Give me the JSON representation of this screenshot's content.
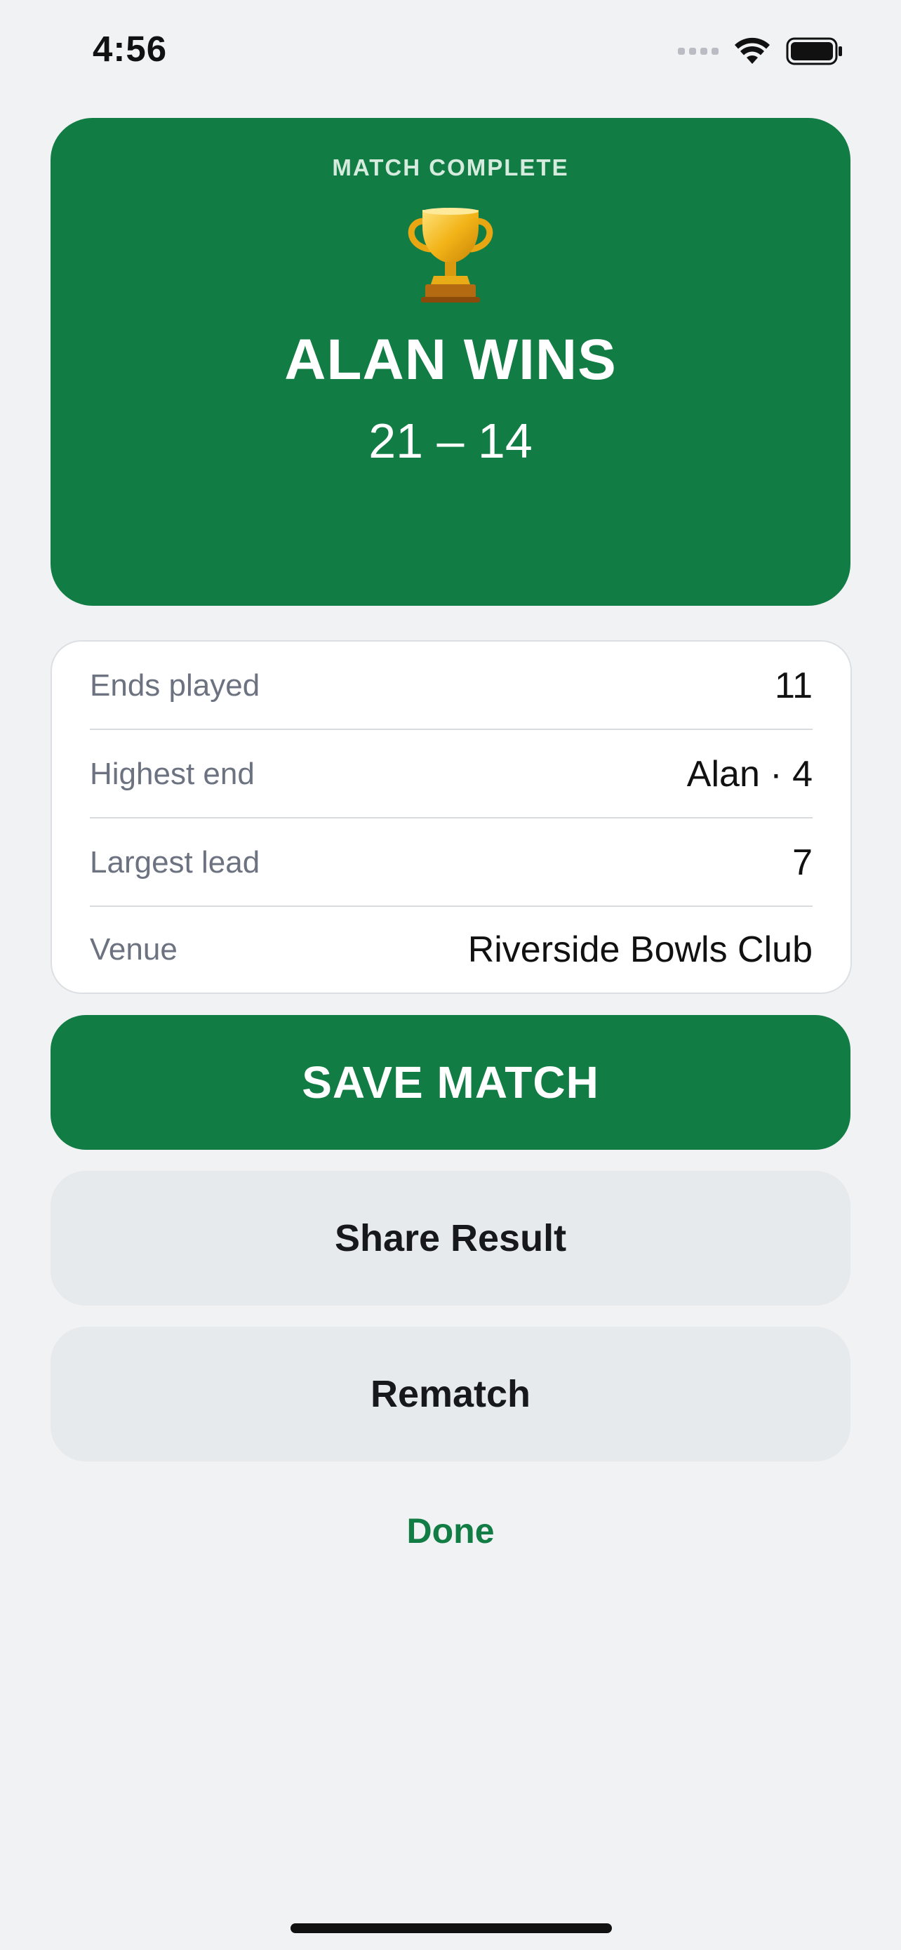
{
  "status_bar": {
    "time": "4:56"
  },
  "result": {
    "label": "MATCH COMPLETE",
    "winner": "ALAN WINS",
    "score": "21 – 14",
    "trophy_icon": "trophy-icon"
  },
  "stats": [
    {
      "label": "Ends played",
      "value": "11"
    },
    {
      "label": "Highest end",
      "value": "Alan · 4"
    },
    {
      "label": "Largest lead",
      "value": "7"
    },
    {
      "label": "Venue",
      "value": "Riverside Bowls Club"
    }
  ],
  "actions": {
    "save_label": "SAVE MATCH",
    "share_label": "Share Result",
    "rematch_label": "Rematch",
    "done_label": "Done"
  },
  "colors": {
    "accent": "#127c45",
    "background": "#f1f2f4",
    "secondary_button": "#e7eaed"
  }
}
